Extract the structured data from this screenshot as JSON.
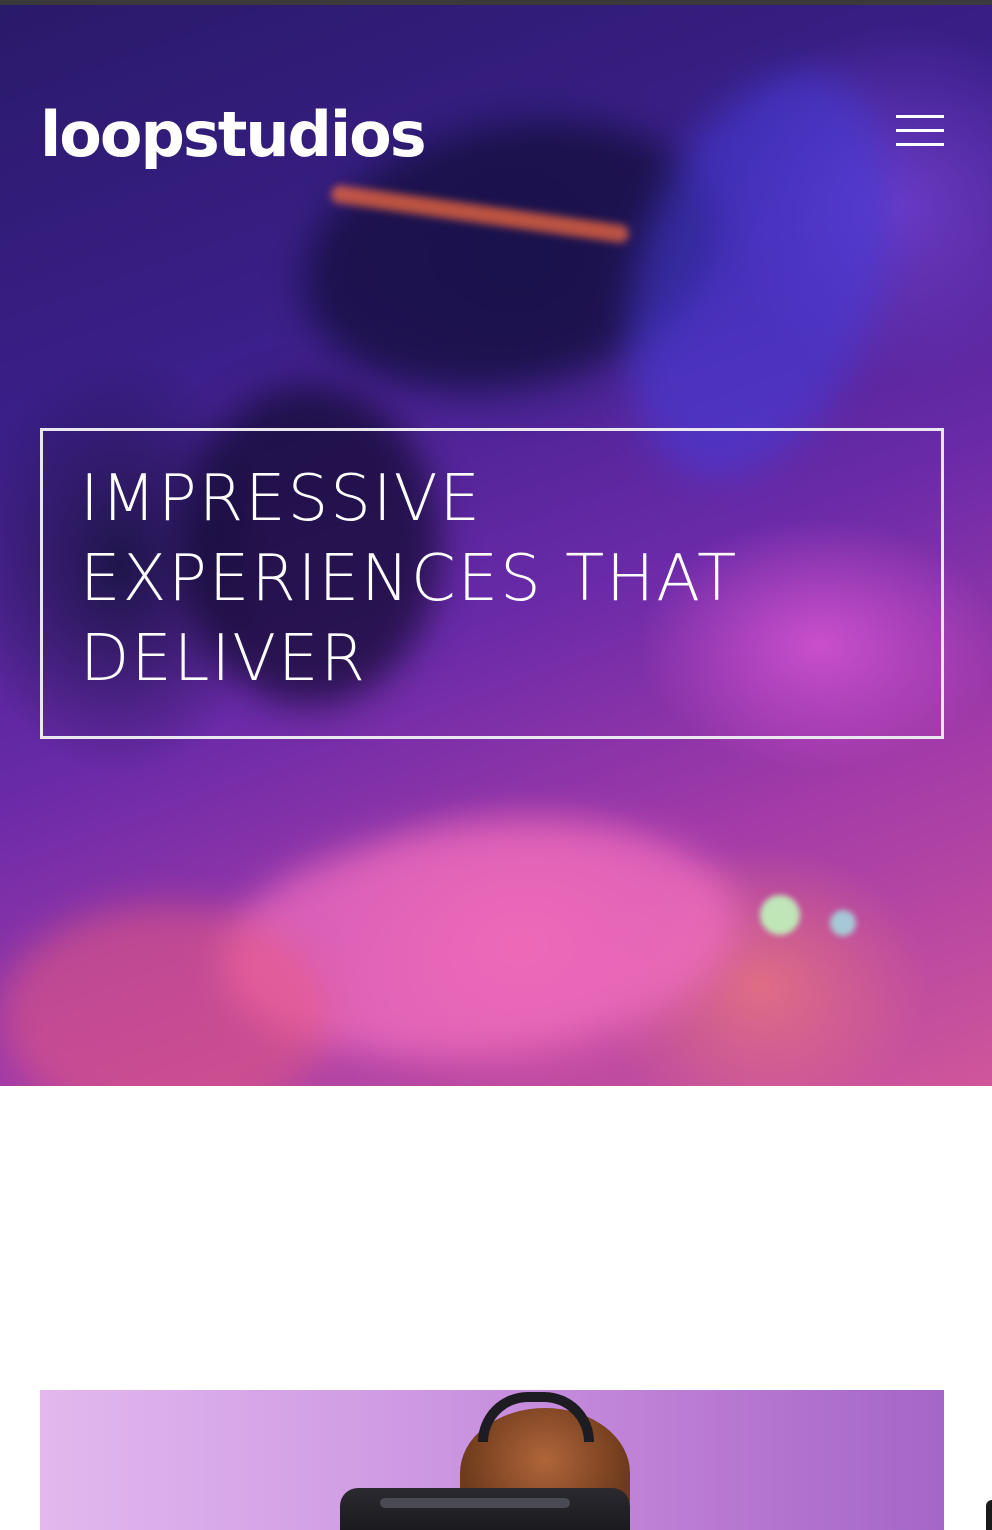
{
  "header": {
    "logo_text": "loopstudios",
    "menu_icon": "hamburger-menu-icon"
  },
  "hero": {
    "headline": "Impressive experiences that deliver"
  },
  "content": {
    "image_subject": "person-wearing-vr-headset"
  }
}
